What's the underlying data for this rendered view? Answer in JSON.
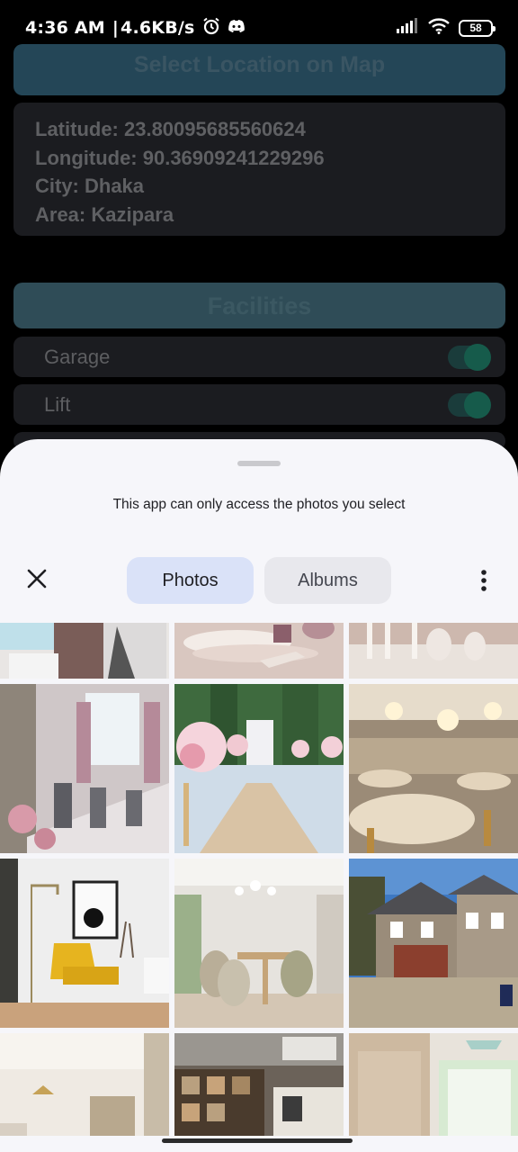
{
  "status_bar": {
    "time": "4:36 AM",
    "separator": "|",
    "network_speed": "4.6KB/s",
    "battery": "58",
    "icons": [
      "alarm-icon",
      "discord-icon",
      "signal-icon",
      "wifi-icon",
      "battery-icon"
    ]
  },
  "background_app": {
    "map_button_label": "Select Location on Map",
    "location": {
      "latitude": "Latitude: 23.80095685560624",
      "longitude": "Longitude: 90.36909241229296",
      "city": "City: Dhaka",
      "area": "Area: Kazipara"
    },
    "facilities_header": "Facilities",
    "facilities": [
      {
        "label": "Garage",
        "enabled": true
      },
      {
        "label": "Lift",
        "enabled": true
      }
    ]
  },
  "photo_picker": {
    "notice": "This app can only access the photos you select",
    "tabs": [
      {
        "label": "Photos",
        "selected": true
      },
      {
        "label": "Albums",
        "selected": false
      }
    ],
    "close_icon": "close-icon",
    "more_icon": "more-vert-icon",
    "accent_color": "#dae2f8",
    "photos": [
      "people-photo",
      "table-setting-photo",
      "glassware-photo",
      "banquet-dining-photo",
      "wedding-aisle-photo",
      "ballroom-photo",
      "yellow-armchair-photo",
      "dining-room-photo",
      "suburban-house-photo",
      "bedroom-photo",
      "office-interior-photo",
      "bright-room-photo"
    ]
  }
}
